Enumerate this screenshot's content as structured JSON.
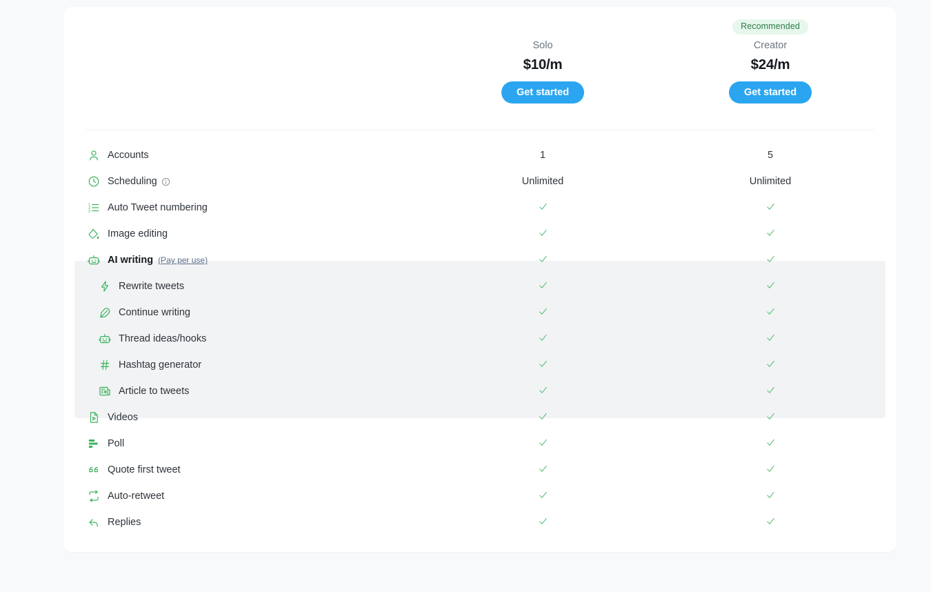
{
  "theme": {
    "page_bg": "#f7f9fb",
    "card_bg": "#ffffff",
    "accent_blue": "#2ba5f0",
    "icon_green": "#3cb35c",
    "check_green": "#59bd78",
    "badge_bg": "#e6f7ec",
    "badge_text": "#2f7d4b",
    "highlight_row_bg": "#f2f3f5",
    "link_color": "#5b7088"
  },
  "plans": [
    {
      "key": "solo",
      "badge": "",
      "name": "Solo",
      "price": "$10/m",
      "cta_label": "Get started"
    },
    {
      "key": "creator",
      "badge": "Recommended",
      "name": "Creator",
      "price": "$24/m",
      "cta_label": "Get started"
    }
  ],
  "features": [
    {
      "icon": "user-icon",
      "label": "Accounts",
      "note": "",
      "info": false,
      "sub": false,
      "bold": false,
      "highlight": false,
      "solo": "1",
      "creator": "5",
      "solo_type": "text",
      "creator_type": "text"
    },
    {
      "icon": "clock-icon",
      "label": "Scheduling",
      "note": "",
      "info": true,
      "sub": false,
      "bold": false,
      "highlight": false,
      "solo": "Unlimited",
      "creator": "Unlimited",
      "solo_type": "text",
      "creator_type": "text"
    },
    {
      "icon": "ordered-list-icon",
      "label": "Auto Tweet numbering",
      "note": "",
      "info": false,
      "sub": false,
      "bold": false,
      "highlight": false,
      "solo": "✓",
      "creator": "✓",
      "solo_type": "check",
      "creator_type": "check"
    },
    {
      "icon": "paint-bucket-icon",
      "label": "Image editing",
      "note": "",
      "info": false,
      "sub": false,
      "bold": false,
      "highlight": false,
      "solo": "✓",
      "creator": "✓",
      "solo_type": "check",
      "creator_type": "check"
    },
    {
      "icon": "robot-icon",
      "label": "AI writing",
      "note": "(Pay per use)",
      "info": false,
      "sub": false,
      "bold": true,
      "highlight": true,
      "solo": "✓",
      "creator": "✓",
      "solo_type": "check",
      "creator_type": "check"
    },
    {
      "icon": "bolt-icon",
      "label": "Rewrite tweets",
      "note": "",
      "info": false,
      "sub": true,
      "bold": false,
      "highlight": true,
      "solo": "✓",
      "creator": "✓",
      "solo_type": "check",
      "creator_type": "check"
    },
    {
      "icon": "feather-icon",
      "label": "Continue writing",
      "note": "",
      "info": false,
      "sub": true,
      "bold": false,
      "highlight": true,
      "solo": "✓",
      "creator": "✓",
      "solo_type": "check",
      "creator_type": "check"
    },
    {
      "icon": "robot-icon",
      "label": "Thread ideas/hooks",
      "note": "",
      "info": false,
      "sub": true,
      "bold": false,
      "highlight": true,
      "solo": "✓",
      "creator": "✓",
      "solo_type": "check",
      "creator_type": "check"
    },
    {
      "icon": "hashtag-icon",
      "label": "Hashtag generator",
      "note": "",
      "info": false,
      "sub": true,
      "bold": false,
      "highlight": true,
      "solo": "✓",
      "creator": "✓",
      "solo_type": "check",
      "creator_type": "check"
    },
    {
      "icon": "article-icon",
      "label": "Article to tweets",
      "note": "",
      "info": false,
      "sub": true,
      "bold": false,
      "highlight": true,
      "solo": "✓",
      "creator": "✓",
      "solo_type": "check",
      "creator_type": "check"
    },
    {
      "icon": "video-file-icon",
      "label": "Videos",
      "note": "",
      "info": false,
      "sub": false,
      "bold": false,
      "highlight": false,
      "solo": "✓",
      "creator": "✓",
      "solo_type": "check",
      "creator_type": "check"
    },
    {
      "icon": "poll-icon",
      "label": "Poll",
      "note": "",
      "info": false,
      "sub": false,
      "bold": false,
      "highlight": false,
      "solo": "✓",
      "creator": "✓",
      "solo_type": "check",
      "creator_type": "check"
    },
    {
      "icon": "quote-icon",
      "label": "Quote first tweet",
      "note": "",
      "info": false,
      "sub": false,
      "bold": false,
      "highlight": false,
      "solo": "✓",
      "creator": "✓",
      "solo_type": "check",
      "creator_type": "check"
    },
    {
      "icon": "retweet-icon",
      "label": "Auto-retweet",
      "note": "",
      "info": false,
      "sub": false,
      "bold": false,
      "highlight": false,
      "solo": "✓",
      "creator": "✓",
      "solo_type": "check",
      "creator_type": "check"
    },
    {
      "icon": "reply-icon",
      "label": "Replies",
      "note": "",
      "info": false,
      "sub": false,
      "bold": false,
      "highlight": false,
      "solo": "✓",
      "creator": "✓",
      "solo_type": "check",
      "creator_type": "check"
    }
  ]
}
